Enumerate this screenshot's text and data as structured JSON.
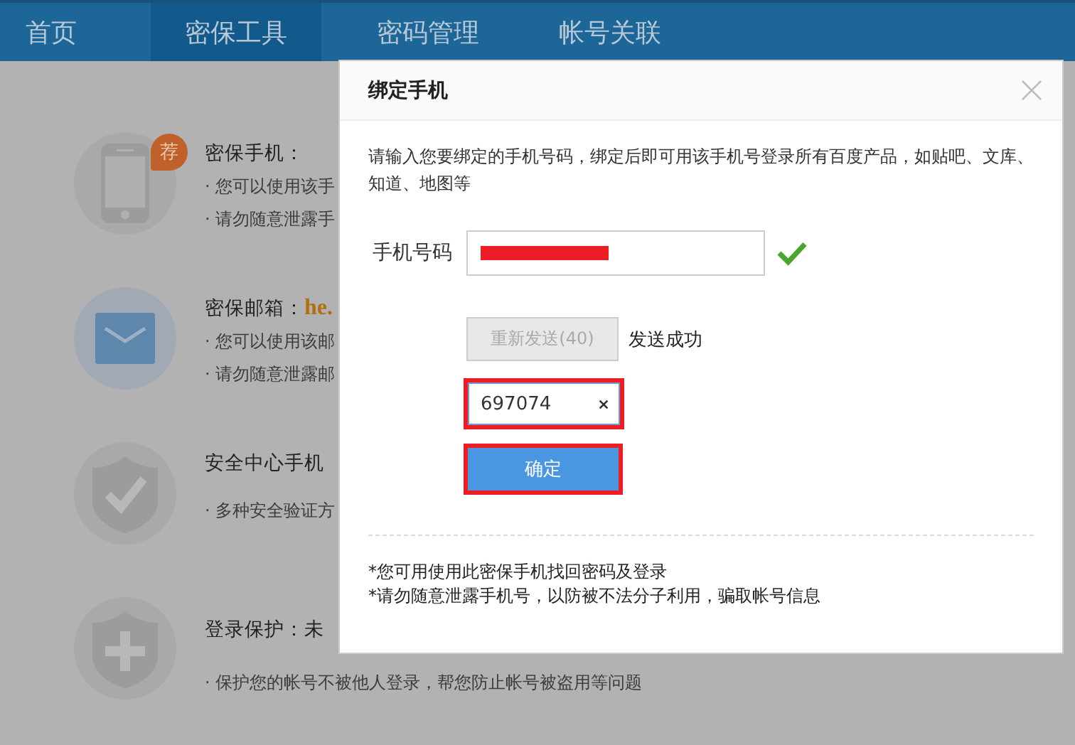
{
  "nav": {
    "tabs": [
      {
        "label": "首页",
        "selected": false
      },
      {
        "label": "密保工具",
        "selected": true
      },
      {
        "label": "密码管理",
        "selected": false
      },
      {
        "label": "帐号关联",
        "selected": false
      }
    ]
  },
  "items": [
    {
      "kind": "phone",
      "title": "密保手机：",
      "badge": "荐",
      "lines": [
        "· 您可以使用该手",
        "· 请勿随意泄露手"
      ]
    },
    {
      "kind": "mail",
      "title": "密保邮箱：",
      "value": "he.",
      "lines": [
        "· 您可以使用该邮",
        "· 请勿随意泄露邮"
      ]
    },
    {
      "kind": "shield-check",
      "title": "安全中心手机",
      "lines": [
        "· 多种安全验证方"
      ]
    },
    {
      "kind": "shield-plus",
      "title": "登录保护：未",
      "lines": [
        "· 保护您的帐号不被他人登录，帮您防止帐号被盗用等问题"
      ]
    }
  ],
  "dialog": {
    "title": "绑定手机",
    "intro": "请输入您要绑定的手机号码，绑定后即可用该手机号登录所有百度产品，如贴吧、文库、知道、地图等",
    "phone_label": "手机号码",
    "phone_redacted": true,
    "phone_valid": true,
    "resend_button": {
      "label": "重新发送(40)",
      "disabled": true
    },
    "send_status": "发送成功",
    "code_field": {
      "value": "697074",
      "highlighted": true
    },
    "confirm_button": {
      "label": "确定",
      "highlighted": true
    },
    "notes": [
      "*您可用使用此密保手机找回密码及登录",
      "*请勿随意泄露手机号，以防被不法分子利用，骗取帐号信息"
    ]
  }
}
